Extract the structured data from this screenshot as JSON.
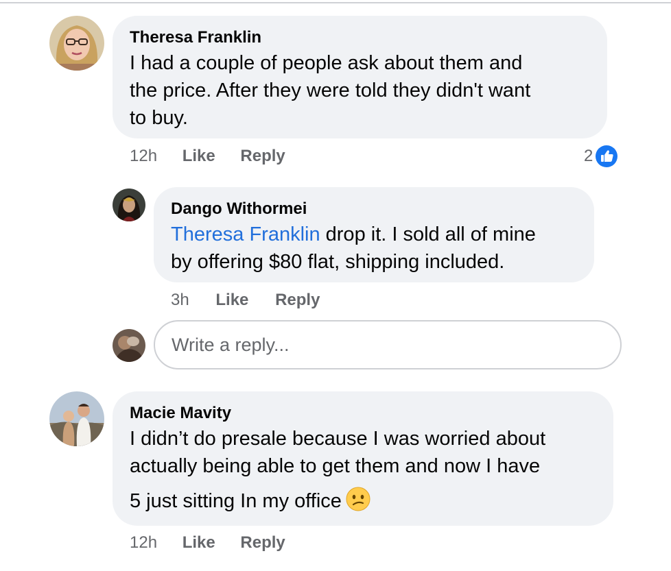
{
  "comments": [
    {
      "author": "Theresa Franklin",
      "lines": [
        "I had a couple of people ask about them and",
        "the price. After they were told they didn't want",
        "to buy."
      ],
      "time": "12h",
      "like_label": "Like",
      "reply_label": "Reply",
      "reaction_count": "2",
      "reaction_icon": "thumbs-up-icon",
      "reaction_color": "#1877f2",
      "replies": [
        {
          "author": "Dango Withormei",
          "mention": "Theresa Franklin",
          "lines": [
            " drop it. I sold all of mine",
            "by offering $80 flat, shipping included."
          ],
          "time": "3h",
          "like_label": "Like",
          "reply_label": "Reply"
        }
      ],
      "reply_input": {
        "placeholder": "Write a reply..."
      }
    },
    {
      "author": "Macie Mavity",
      "lines": [
        "I didn’t do presale because I was worried about",
        "actually being able to get them and now I have",
        "5 just sitting In my office"
      ],
      "emoji": "confused-face-icon",
      "time": "12h",
      "like_label": "Like",
      "reply_label": "Reply"
    }
  ],
  "colors": {
    "bubble": "#f0f2f5",
    "mention": "#216fdb",
    "meta": "#65676b",
    "text": "#050505"
  }
}
